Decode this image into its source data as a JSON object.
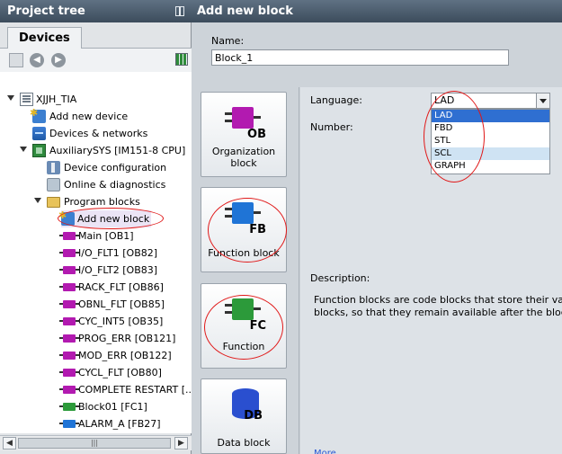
{
  "project_tree": {
    "title": "Project tree",
    "tab": "Devices",
    "items": [
      {
        "label": "XJJH_TIA",
        "icon": "project-icon"
      },
      {
        "label": "Add new device",
        "icon": "add-device-icon"
      },
      {
        "label": "Devices & networks",
        "icon": "network-icon"
      },
      {
        "label": "AuxiliarySYS [IM151-8 CPU]",
        "icon": "cpu-icon"
      },
      {
        "label": "Device configuration",
        "icon": "device-config-icon"
      },
      {
        "label": "Online & diagnostics",
        "icon": "diagnostics-icon"
      },
      {
        "label": "Program blocks",
        "icon": "folder-icon"
      },
      {
        "label": "Add new block",
        "icon": "add-block-icon"
      },
      {
        "label": "Main [OB1]",
        "icon": "ob-block-icon"
      },
      {
        "label": "I/O_FLT1 [OB82]",
        "icon": "ob-block-icon"
      },
      {
        "label": "I/O_FLT2 [OB83]",
        "icon": "ob-block-icon"
      },
      {
        "label": "RACK_FLT [OB86]",
        "icon": "ob-block-icon"
      },
      {
        "label": "OBNL_FLT [OB85]",
        "icon": "ob-block-icon"
      },
      {
        "label": "CYC_INT5 [OB35]",
        "icon": "ob-block-icon"
      },
      {
        "label": "PROG_ERR [OB121]",
        "icon": "ob-block-icon"
      },
      {
        "label": "MOD_ERR [OB122]",
        "icon": "ob-block-icon"
      },
      {
        "label": "CYCL_FLT [OB80]",
        "icon": "ob-block-icon"
      },
      {
        "label": "COMPLETE RESTART [...",
        "icon": "ob-block-icon"
      },
      {
        "label": "Block01 [FC1]",
        "icon": "fc-block-icon"
      },
      {
        "label": "ALARM_A [FB27]",
        "icon": "fb-block-icon"
      }
    ]
  },
  "dialog": {
    "title": "Add new block",
    "name_label": "Name:",
    "name_value": "Block_1",
    "block_types": [
      {
        "code": "OB",
        "label": "Organization block",
        "color": "#b21ab0"
      },
      {
        "code": "FB",
        "label": "Function block",
        "color": "#1f74d6"
      },
      {
        "code": "FC",
        "label": "Function",
        "color": "#2c9a3a"
      },
      {
        "code": "DB",
        "label": "Data block",
        "color": "#2a4fcf"
      }
    ],
    "language_label": "Language:",
    "language_value": "LAD",
    "language_options": [
      "LAD",
      "FBD",
      "STL",
      "SCL",
      "GRAPH"
    ],
    "number_label": "Number:",
    "description_label": "Description:",
    "description_lines": [
      "Function blocks are code blocks that store their val",
      "blocks, so that they remain available after the bloc"
    ],
    "more_link": "More..."
  },
  "colors": {
    "annotation": "#e01818",
    "title_bar": "#4a5b6c",
    "selected": "#2f6fd1"
  }
}
